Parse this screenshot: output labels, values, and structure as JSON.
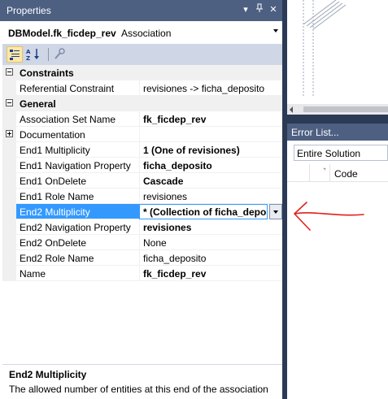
{
  "properties": {
    "title": "Properties",
    "object_name": "DBModel.fk_ficdep_rev",
    "object_type": "Association",
    "categories": {
      "constraints": "Constraints",
      "general": "General"
    },
    "rows": {
      "referential_constraint": {
        "name": "Referential Constraint",
        "value": "revisiones -> ficha_deposito"
      },
      "association_set_name": {
        "name": "Association Set Name",
        "value": "fk_ficdep_rev"
      },
      "documentation": {
        "name": "Documentation",
        "value": ""
      },
      "end1_multiplicity": {
        "name": "End1 Multiplicity",
        "value": "1 (One of revisiones)"
      },
      "end1_navigation_property": {
        "name": "End1 Navigation Property",
        "value": "ficha_deposito"
      },
      "end1_ondelete": {
        "name": "End1 OnDelete",
        "value": "Cascade"
      },
      "end1_role_name": {
        "name": "End1 Role Name",
        "value": "revisiones"
      },
      "end2_multiplicity": {
        "name": "End2 Multiplicity",
        "value": "* (Collection of ficha_deposi"
      },
      "end2_navigation_property": {
        "name": "End2 Navigation Property",
        "value": "revisiones"
      },
      "end2_ondelete": {
        "name": "End2 OnDelete",
        "value": "None"
      },
      "end2_role_name": {
        "name": "End2 Role Name",
        "value": "ficha_deposito"
      },
      "name": {
        "name": "Name",
        "value": "fk_ficdep_rev"
      }
    },
    "description": {
      "title": "End2 Multiplicity",
      "text": "The allowed number of entities at this end of the association"
    }
  },
  "error_list": {
    "title": "Error List...",
    "scope": "Entire Solution",
    "column_code": "Code"
  },
  "colors": {
    "title_bar": "#4d6082",
    "selection": "#3399ff",
    "annotation": "#e0201b"
  }
}
